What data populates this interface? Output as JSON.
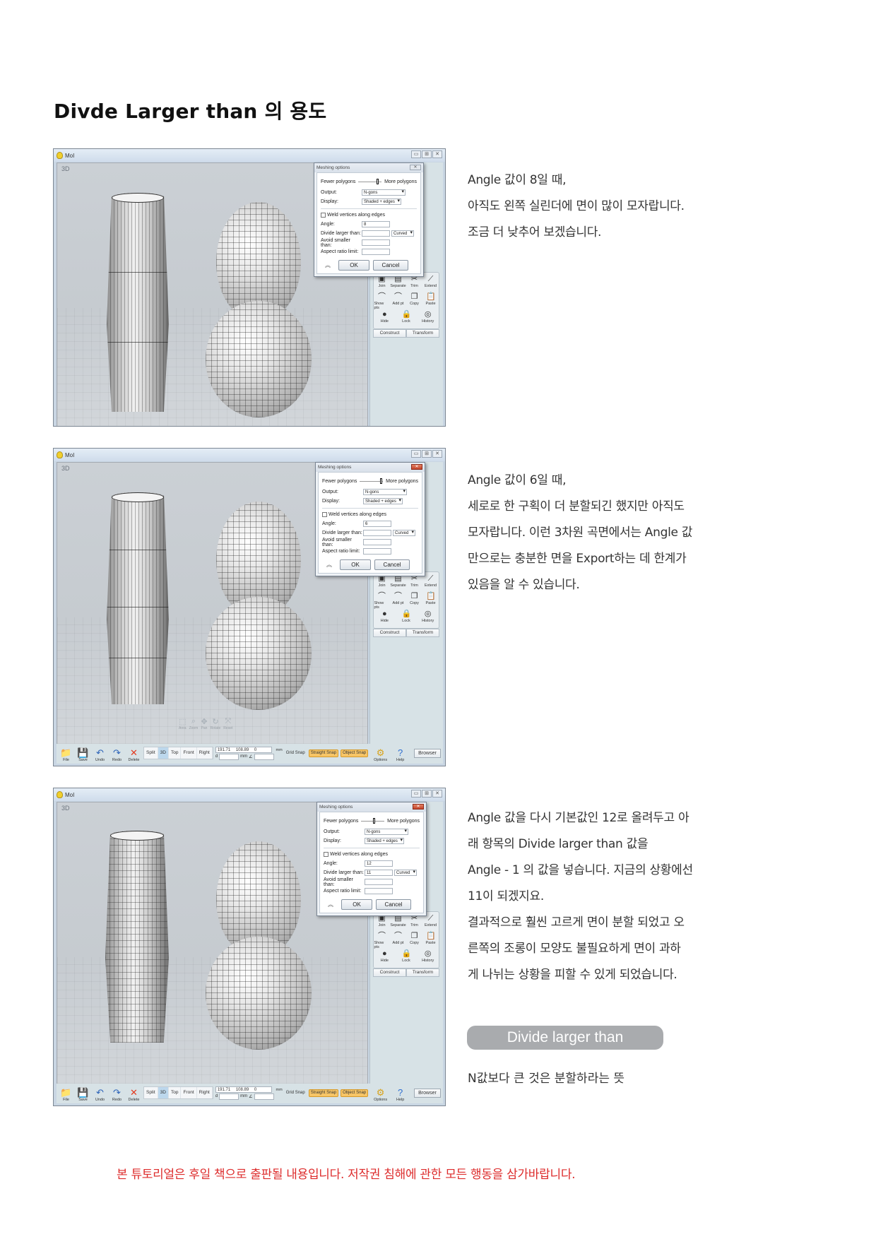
{
  "page": {
    "title": "Divde Larger than 의 용도",
    "footer_notice": "본 튜토리얼은 후일 책으로 출판될 내용입니다. 저작권 침해에 관한 모든 행동을 삼가바랍니다.",
    "colors": {
      "notice": "#dd2c2c",
      "pill_bg": "#a9abae",
      "active_view_tab": "#bcd7ec",
      "snap_on": "#f7c566"
    }
  },
  "app_common": {
    "window_title": "MoI",
    "viewport_label": "3D",
    "window_controls": [
      "minimize",
      "maximize",
      "close"
    ],
    "dialog": {
      "title": "Meshing options",
      "slider_left": "Fewer polygons",
      "slider_right": "More polygons",
      "output_label": "Output:",
      "output_value": "N-gons",
      "display_label": "Display:",
      "display_value": "Shaded + edges",
      "weld_label": "Weld vertices along edges",
      "weld_checked": false,
      "angle_label": "Angle:",
      "divide_label": "Divide larger than:",
      "divide_mode": "Curved",
      "avoid_label": "Avoid smaller than:",
      "aspect_label": "Aspect ratio limit:",
      "ok_label": "OK",
      "cancel_label": "Cancel",
      "expand_icon": "double-chevron-up-icon"
    },
    "palette": {
      "rows": [
        [
          {
            "label": "Join",
            "icon": "join-icon"
          },
          {
            "label": "Separate",
            "icon": "separate-icon"
          },
          {
            "label": "Trim",
            "icon": "scissors-icon"
          },
          {
            "label": "Extend",
            "icon": "extend-icon"
          }
        ],
        [
          {
            "label": "Show pts",
            "icon": "show-points-icon"
          },
          {
            "label": "Add pt",
            "icon": "add-point-icon"
          },
          {
            "label": "Copy",
            "icon": "copy-icon"
          },
          {
            "label": "Paste",
            "icon": "paste-icon"
          }
        ],
        [
          {
            "label": "Hide",
            "icon": "hide-icon"
          },
          {
            "label": "Lock",
            "icon": "lock-icon"
          },
          {
            "label": "History",
            "icon": "history-icon"
          }
        ]
      ],
      "tabs": [
        "Construct",
        "Transform"
      ]
    },
    "nav_hints": [
      "Area",
      "Zoom",
      "Pan",
      "Rotate",
      "Reset"
    ],
    "toolbar": {
      "file": "File",
      "save": "Save",
      "undo": "Undo",
      "redo": "Redo",
      "delete": "Delete",
      "view_tabs": [
        "Split",
        "3D",
        "Top",
        "Front",
        "Right"
      ],
      "active_view": "3D",
      "coords": "191.71   108.89   0",
      "unit": "mm",
      "distance_prefix": "d",
      "angle_symbol": "∠",
      "grid_snap": "Grid Snap",
      "straight_snap": "Straight Snap",
      "object_snap": "Object Snap",
      "options": "Options",
      "help": "Help",
      "browser": "Browser"
    }
  },
  "sections": [
    {
      "angle_value": "8",
      "divide_value": "",
      "slider_position": 0.78,
      "has_toolbar": false,
      "text": [
        "Angle 값이 8일 때,",
        "아직도 왼쪽 실린더에 면이 많이 모자랍니다.",
        "조금 더 낮추어 보겠습니다."
      ]
    },
    {
      "angle_value": "6",
      "divide_value": "",
      "slider_position": 0.88,
      "has_toolbar": true,
      "text": [
        "Angle 값이 6일 때,",
        "세로로 한 구획이 더 분할되긴 했지만 아직도",
        "모자랍니다. 이런 3차원 곡면에서는 Angle 값",
        "만으로는 충분한 면을 Export하는 데 한계가",
        "있음을 알 수 있습니다."
      ]
    },
    {
      "angle_value": "12",
      "divide_value": "11",
      "slider_position": 0.5,
      "has_toolbar": true,
      "text": [
        "Angle 값을 다시 기본값인 12로 올려두고 아",
        "래 항목의 Divide larger than 값을",
        "Angle - 1 의 값을 넣습니다. 지금의 상황에선",
        "11이 되겠지요.",
        "결과적으로 훨씬 고르게 면이 분할 되었고 오",
        "른쪽의 조롱이 모양도 불필요하게 면이 과하",
        "게 나뉘는 상황을 피할 수 있게 되었습니다."
      ]
    }
  ],
  "callout": {
    "label": "Divide larger than",
    "description": "N값보다 큰 것은 분할하라는 뜻"
  }
}
